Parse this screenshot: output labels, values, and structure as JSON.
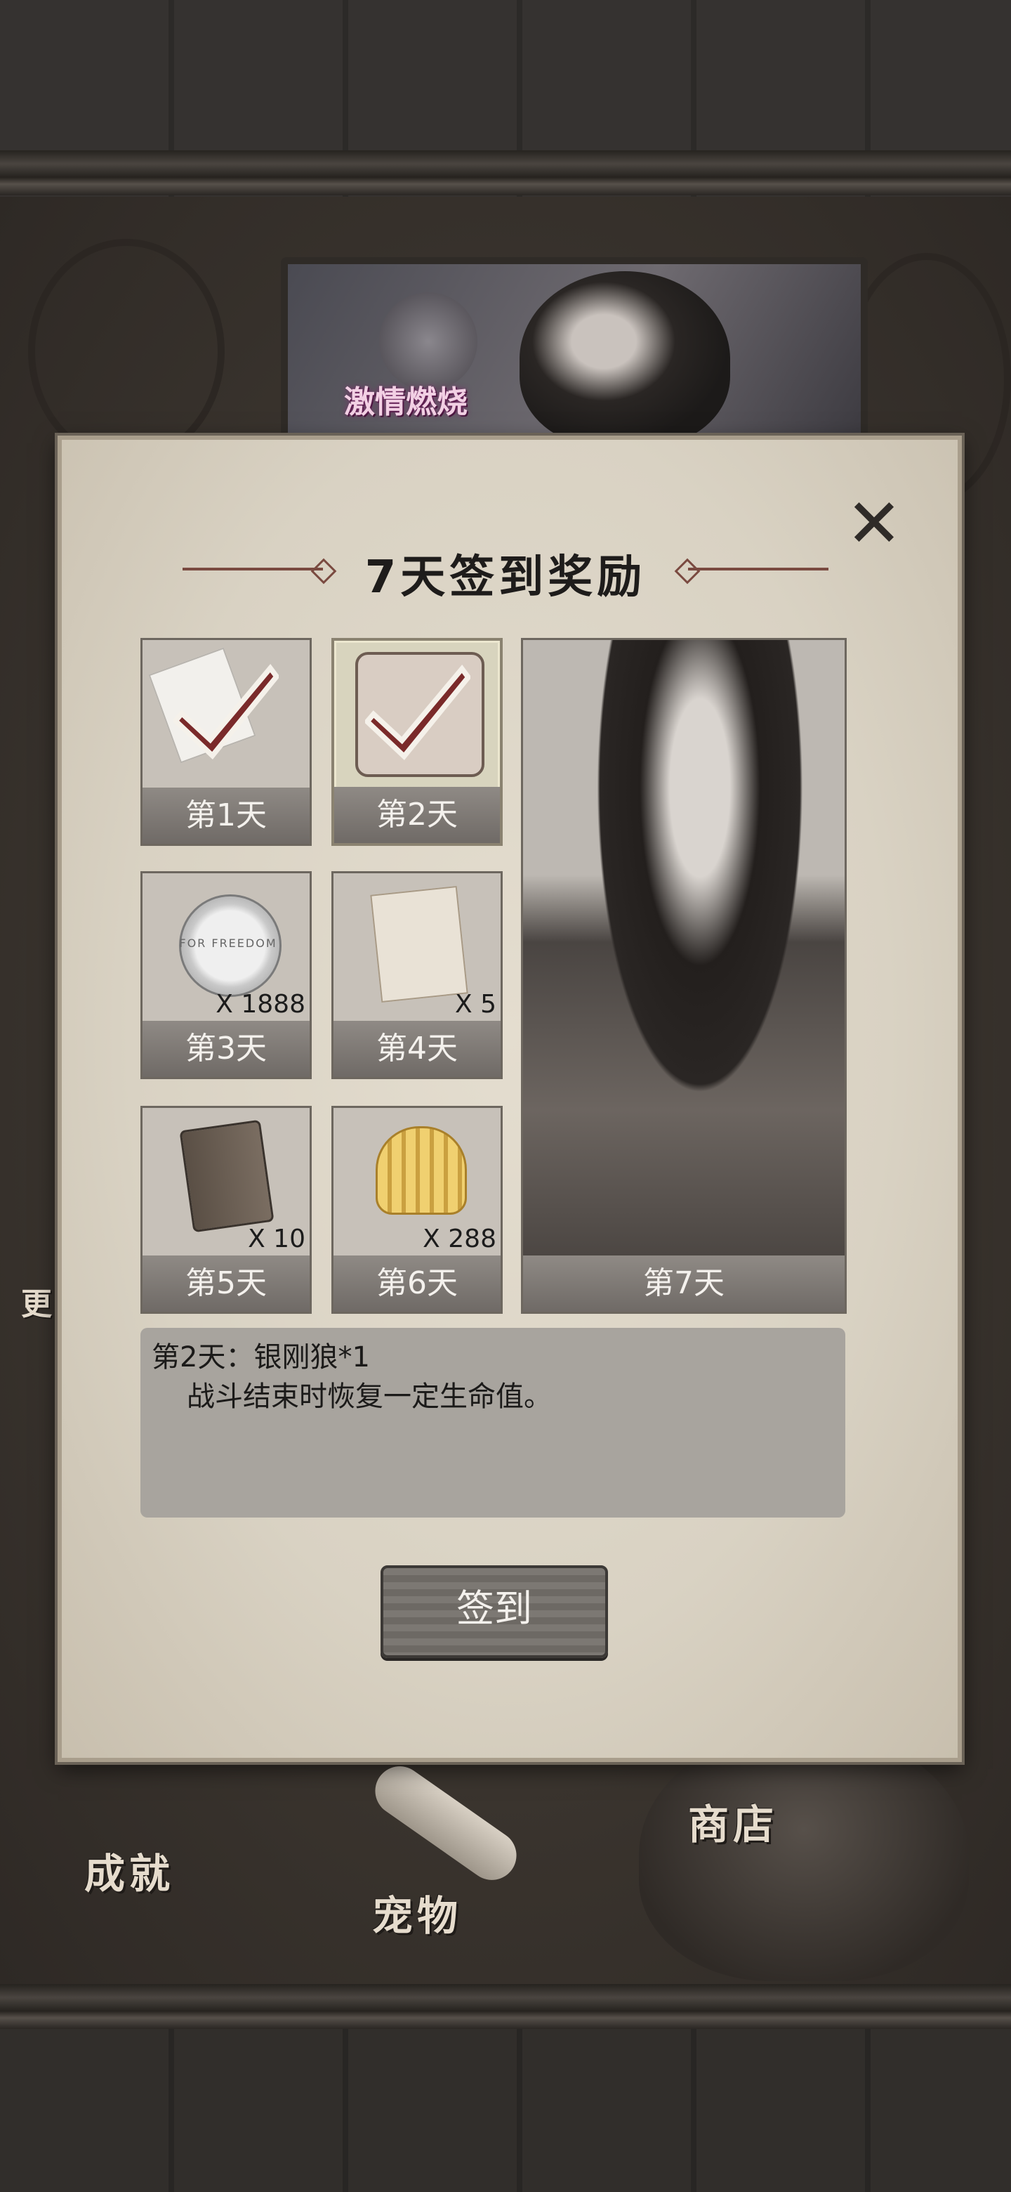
{
  "background": {
    "banner_text": "激情燃烧",
    "menu": {
      "achievements_label": "成就",
      "pets_label": "宠物",
      "shop_label": "商店",
      "side_label": "更"
    }
  },
  "dialog": {
    "title": "7天签到奖励",
    "close_icon": "close-icon",
    "rewards": [
      {
        "day_label": "第1天",
        "icon": "document-icon",
        "quantity": "",
        "claimed": true
      },
      {
        "day_label": "第2天",
        "icon": "pet-icon",
        "quantity": "",
        "claimed": true,
        "selected": true
      },
      {
        "day_label": "第3天",
        "icon": "coin-icon",
        "quantity": "X 1888",
        "claimed": false
      },
      {
        "day_label": "第4天",
        "icon": "paper-icon",
        "quantity": "X 5",
        "claimed": false
      },
      {
        "day_label": "第5天",
        "icon": "book-icon",
        "quantity": "X 10",
        "claimed": false
      },
      {
        "day_label": "第6天",
        "icon": "shell-icon",
        "quantity": "X 288",
        "claimed": false
      },
      {
        "day_label": "第7天",
        "icon": "character-portrait",
        "quantity": "",
        "claimed": false
      }
    ],
    "description": {
      "line1": "第2天：银刚狼*1",
      "line2": "战斗结束时恢复一定生命值。"
    },
    "sign_in_button": "签到",
    "coin_engraving": "FOR FREEDOM"
  },
  "colors": {
    "check_mark": "#7a2a2a",
    "label_bar": "#7d7873",
    "panel": "#ddd6c8"
  }
}
